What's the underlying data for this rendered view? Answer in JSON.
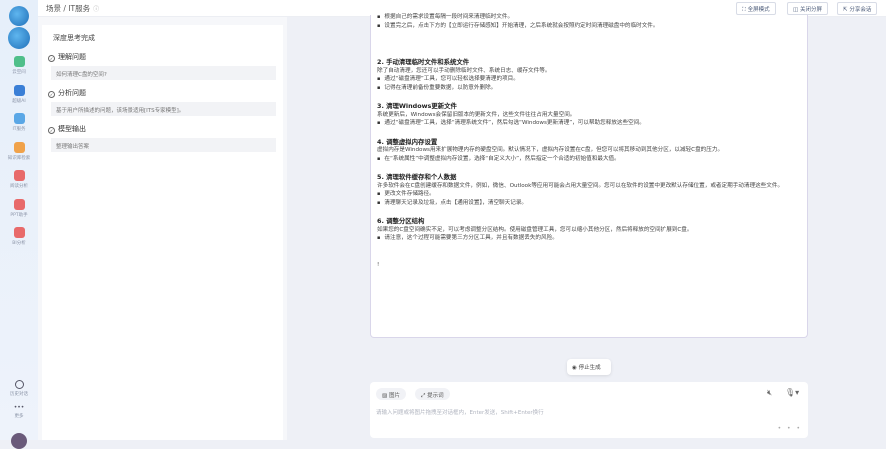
{
  "sidebar": {
    "items": [
      {
        "label": "云空间",
        "color": "#4fbf8a"
      },
      {
        "label": "超级AI",
        "color": "#3a7fd6"
      },
      {
        "label": "IT服务",
        "color": "#5aa7e6"
      },
      {
        "label": "知识库检索",
        "color": "#f0a24a"
      },
      {
        "label": "阅读分析",
        "color": "#e86a6a"
      },
      {
        "label": "PPT助手",
        "color": "#e86a6a"
      },
      {
        "label": "BI分析",
        "color": "#e86a6a"
      }
    ],
    "history": "历史对话",
    "more": "更多"
  },
  "header": {
    "breadcrumb": "场景 / IT服务",
    "fullscreen": "全屏模式",
    "close_split": "关闭分屏",
    "share": "分享会话"
  },
  "thinking": {
    "title": "深度思考完成",
    "steps": [
      {
        "label": "理解问题",
        "detail": "如何清理C盘的空间?"
      },
      {
        "label": "分析问题",
        "detail": "基于用户所描述的问题，该场景适用[ITS专家模型]。"
      },
      {
        "label": "模型输出",
        "detail": "整理输出答案"
      }
    ]
  },
  "answer": {
    "top_bullets": [
      "根据自己的需求设置每隔一段时间来清理临时文件。",
      "设置完之后，点击下方的【立即运行存储感知】开始清理，之后系统就会按照约定时间清理磁盘中的临时文件。"
    ],
    "sections": [
      {
        "title": "2. 手动清理临时文件和系统文件",
        "text": "除了自动清理，您还可以手动删除临时文件、系统日志、缓存文件等。",
        "bullets": [
          "通过“磁盘清理”工具，您可以轻松选择要清理的项目。",
          "记得在清理前备份重要数据，以防意外删除。"
        ]
      },
      {
        "title": "3. 清理Windows更新文件",
        "text": "系统更新后，Windows会保留旧版本的更新文件，这些文件往往占用大量空间。",
        "bullets": [
          "通过“磁盘清理”工具，选择“清理系统文件”，然后勾选“Windows更新清理”，可以帮助您释放这些空间。"
        ]
      },
      {
        "title": "4. 调整虚拟内存设置",
        "text": "虚拟内存是Windows用来扩展物理内存的硬盘空间。默认情况下，虚拟内存设置在C盘，但您可以将其移动到其他分区，以减轻C盘的压力。",
        "bullets": [
          "在“系统属性”中调整虚拟内存设置，选择“自定义大小”，然后指定一个合适的初始值和最大值。"
        ]
      },
      {
        "title": "5. 清理软件缓存和个人数据",
        "text": "许多软件会在C盘创建缓存和数据文件，例如，微信、Outlook等应用可能会占用大量空间。您可以在软件的设置中更改默认存储位置，或者定期手动清理这些文件。",
        "bullets": [
          "更改文件存储路径。",
          "清理聊天记录及垃圾，点击【通用设置】，清空聊天记录。"
        ]
      },
      {
        "title": "6. 调整分区结构",
        "text": "如果您的C盘空间确实不足，可以考虑调整分区结构。使用磁盘管理工具，您可以缩小其他分区，然后将释放的空间扩展到C盘。",
        "bullets": [
          "请注意，这个过程可能需要第三方分区工具，并且有数据丢失的风险。"
        ]
      }
    ],
    "cursor": "!"
  },
  "stop_label": "停止生成",
  "composer": {
    "image": "图片",
    "prompt": "提示词",
    "placeholder": "请输入问题或将图片拖拽至对话框内，Enter发送，Shift+Enter换行",
    "more": "• • •"
  }
}
